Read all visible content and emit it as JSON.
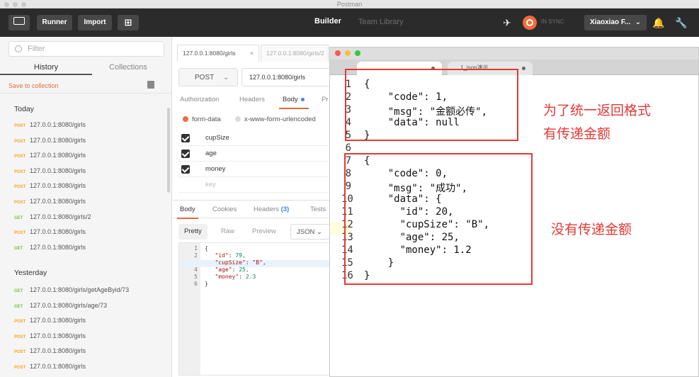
{
  "window": {
    "title": "Postman"
  },
  "toolbar": {
    "runner": "Runner",
    "import": "Import",
    "tab_builder": "Builder",
    "tab_team": "Team Library",
    "sync": "IN SYNC",
    "user": "Xiaoxiao F..."
  },
  "sidebar": {
    "filter_placeholder": "Filter",
    "tab_history": "History",
    "tab_collections": "Collections",
    "save": "Save to collection",
    "today": "Today",
    "yesterday": "Yesterday",
    "today_items": [
      {
        "method": "POST",
        "url": "127.0.0.1:8080/girls"
      },
      {
        "method": "POST",
        "url": "127.0.0.1:8080/girls"
      },
      {
        "method": "POST",
        "url": "127.0.0.1:8080/girls"
      },
      {
        "method": "POST",
        "url": "127.0.0.1:8080/girls"
      },
      {
        "method": "POST",
        "url": "127.0.0.1:8080/girls"
      },
      {
        "method": "POST",
        "url": "127.0.0.1:8080/girls"
      },
      {
        "method": "GET",
        "url": "127.0.0.1:8080/girls/2"
      },
      {
        "method": "POST",
        "url": "127.0.0.1:8080/girls"
      },
      {
        "method": "GET",
        "url": "127.0.0.1:8080/girls"
      }
    ],
    "yesterday_items": [
      {
        "method": "GET",
        "url": "127.0.0.1:8080/girls/getAgeByid/73"
      },
      {
        "method": "GET",
        "url": "127.0.0.1:8080/girls/age/73"
      },
      {
        "method": "POST",
        "url": "127.0.0.1:8080/girls"
      },
      {
        "method": "POST",
        "url": "127.0.0.1:8080/girls"
      },
      {
        "method": "POST",
        "url": "127.0.0.1:8080/girls"
      },
      {
        "method": "POST",
        "url": "127.0.0.1:8080/girls"
      }
    ]
  },
  "request": {
    "tab1": "127.0.0.1:8080/girls",
    "tab2": "127.0.0.1:8080/girls/2",
    "method": "POST",
    "url": "127.0.0.1:8080/girls",
    "subtabs": [
      "Authorization",
      "Headers",
      "Body",
      "Pr"
    ],
    "radio_form": "form-data",
    "radio_urlenc": "x-www-form-urlencoded",
    "keys": [
      "cupSize",
      "age",
      "money"
    ],
    "key_placeholder": "key"
  },
  "response": {
    "tabs": [
      "Body",
      "Cookies",
      "Headers",
      "Tests"
    ],
    "headers_count": "(3)",
    "view_modes": [
      "Pretty",
      "Raw",
      "Preview"
    ],
    "format": "JSON",
    "lines": [
      {
        "n": "1",
        "text": "{"
      },
      {
        "n": "2",
        "key": "\"id\"",
        "val": "79,"
      },
      {
        "n": "3",
        "key": "\"cupSize\"",
        "val": "\"B\","
      },
      {
        "n": "4",
        "key": "\"age\"",
        "val": "25,"
      },
      {
        "n": "5",
        "key": "\"money\"",
        "val": "2.3"
      },
      {
        "n": "6",
        "text": "}"
      }
    ]
  },
  "json_window": {
    "tab1": "",
    "tab2": "1_json演示",
    "lines": [
      "{",
      "    \"code\": 1,",
      "    \"msg\": \"金额必传\",",
      "    \"data\": null",
      "}",
      "",
      "{",
      "    \"code\": 0,",
      "    \"msg\": \"成功\",",
      "    \"data\": {",
      "      \"id\": 20,",
      "      \"cupSize\": \"B\",",
      "      \"age\": 25,",
      "      \"money\": 1.2",
      "    }",
      "}"
    ]
  },
  "annotations": {
    "note1_line1": "为了统一返回格式",
    "note1_line2": "有传递金额",
    "note2": "没有传递金额"
  },
  "colors": {
    "post": "#f5a623",
    "get": "#7cc242",
    "accent": "#e06c3c",
    "annotation": "#e53935"
  }
}
